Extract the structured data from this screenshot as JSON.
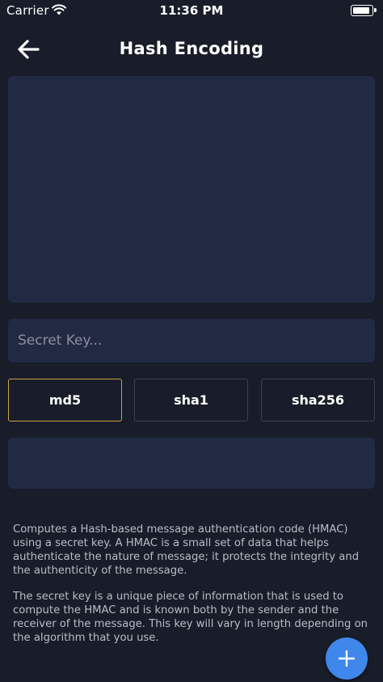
{
  "status_bar": {
    "carrier": "Carrier",
    "time": "11:36 PM"
  },
  "nav": {
    "title": "Hash Encoding",
    "back_icon": "arrow-left-icon"
  },
  "message_input": {
    "value": "",
    "placeholder": ""
  },
  "secret_key_input": {
    "value": "",
    "placeholder": "Secret Key..."
  },
  "algorithms": [
    {
      "label": "md5",
      "selected": true
    },
    {
      "label": "sha1",
      "selected": false
    },
    {
      "label": "sha256",
      "selected": false
    }
  ],
  "output": {
    "value": ""
  },
  "description": {
    "paragraph1": "Computes a Hash-based message authentication code (HMAC) using a secret key. A HMAC is a small set of data that helps authenticate the nature of message; it protects the integrity and the authenticity of the message.",
    "paragraph2": "The secret key is a unique piece of information that is used to compute the HMAC and is known both by the sender and the receiver of the message. This key will vary in length depending on the algorithm that you use."
  },
  "fab": {
    "icon": "plus-icon"
  },
  "colors": {
    "background": "#181d29",
    "field_background": "#222942",
    "selected_border": "#c9a24a",
    "button_border": "#3b4154",
    "fab": "#3f87ea"
  }
}
